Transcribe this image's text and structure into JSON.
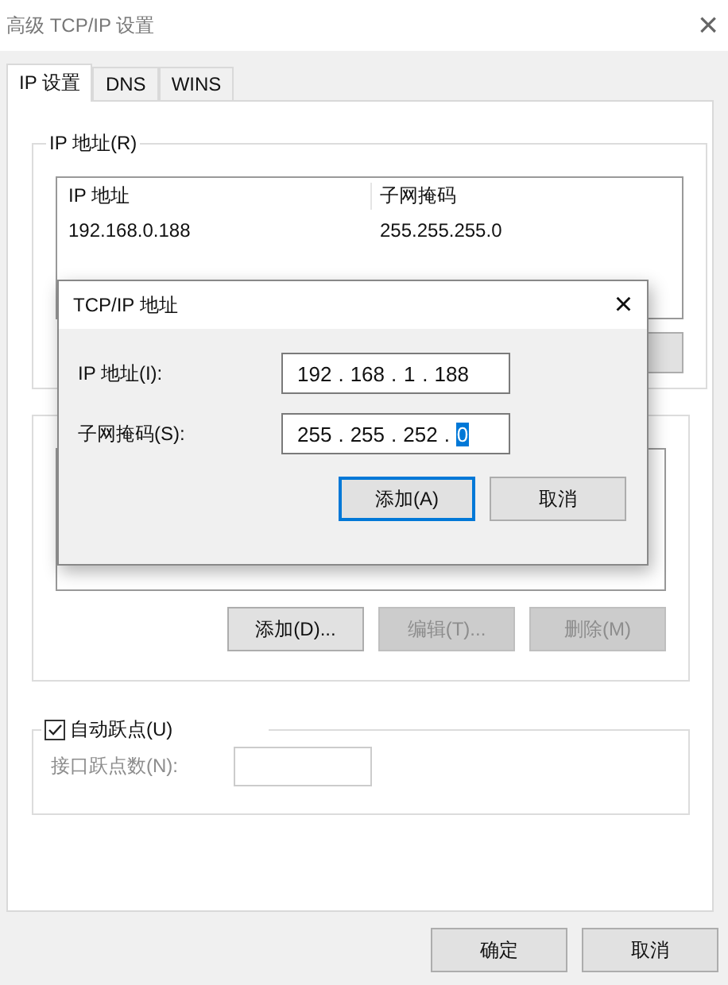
{
  "window": {
    "title": "高级 TCP/IP 设置",
    "close": "×"
  },
  "tabs": [
    {
      "label": "IP 设置",
      "selected": true
    },
    {
      "label": "DNS",
      "selected": false
    },
    {
      "label": "WINS",
      "selected": false
    }
  ],
  "ip_group": {
    "legend": "IP 地址(R)",
    "columns": [
      "IP 地址",
      "子网掩码"
    ],
    "rows": [
      [
        "192.168.0.188",
        "255.255.255.0"
      ]
    ]
  },
  "gateway_group": {
    "buttons": [
      {
        "label": "添加(D)...",
        "disabled": false
      },
      {
        "label": "编辑(T)...",
        "disabled": true
      },
      {
        "label": "删除(M)",
        "disabled": true
      }
    ]
  },
  "metric_group": {
    "checkbox": {
      "label": "自动跃点(U)",
      "checked": true
    },
    "field": {
      "label": "接口跃点数(N):",
      "disabled": true
    }
  },
  "buttons": [
    {
      "label": "确定"
    },
    {
      "label": "取消"
    }
  ],
  "dialog": {
    "title": "TCP/IP 地址",
    "close": "×",
    "separator": ".",
    "fields": [
      {
        "label": "IP 地址(I):",
        "octets": [
          {
            "value": "192",
            "selected": false
          },
          {
            "value": "168",
            "selected": false
          },
          {
            "value": "1",
            "selected": false
          },
          {
            "value": "188",
            "selected": false
          }
        ]
      },
      {
        "label": "子网掩码(S):",
        "octets": [
          {
            "value": "255",
            "selected": false
          },
          {
            "value": "255",
            "selected": false
          },
          {
            "value": "252",
            "selected": false
          },
          {
            "value": "0",
            "selected": true
          }
        ]
      }
    ],
    "buttons": [
      {
        "label": "添加(A)",
        "default": true
      },
      {
        "label": "取消",
        "default": false
      }
    ]
  }
}
